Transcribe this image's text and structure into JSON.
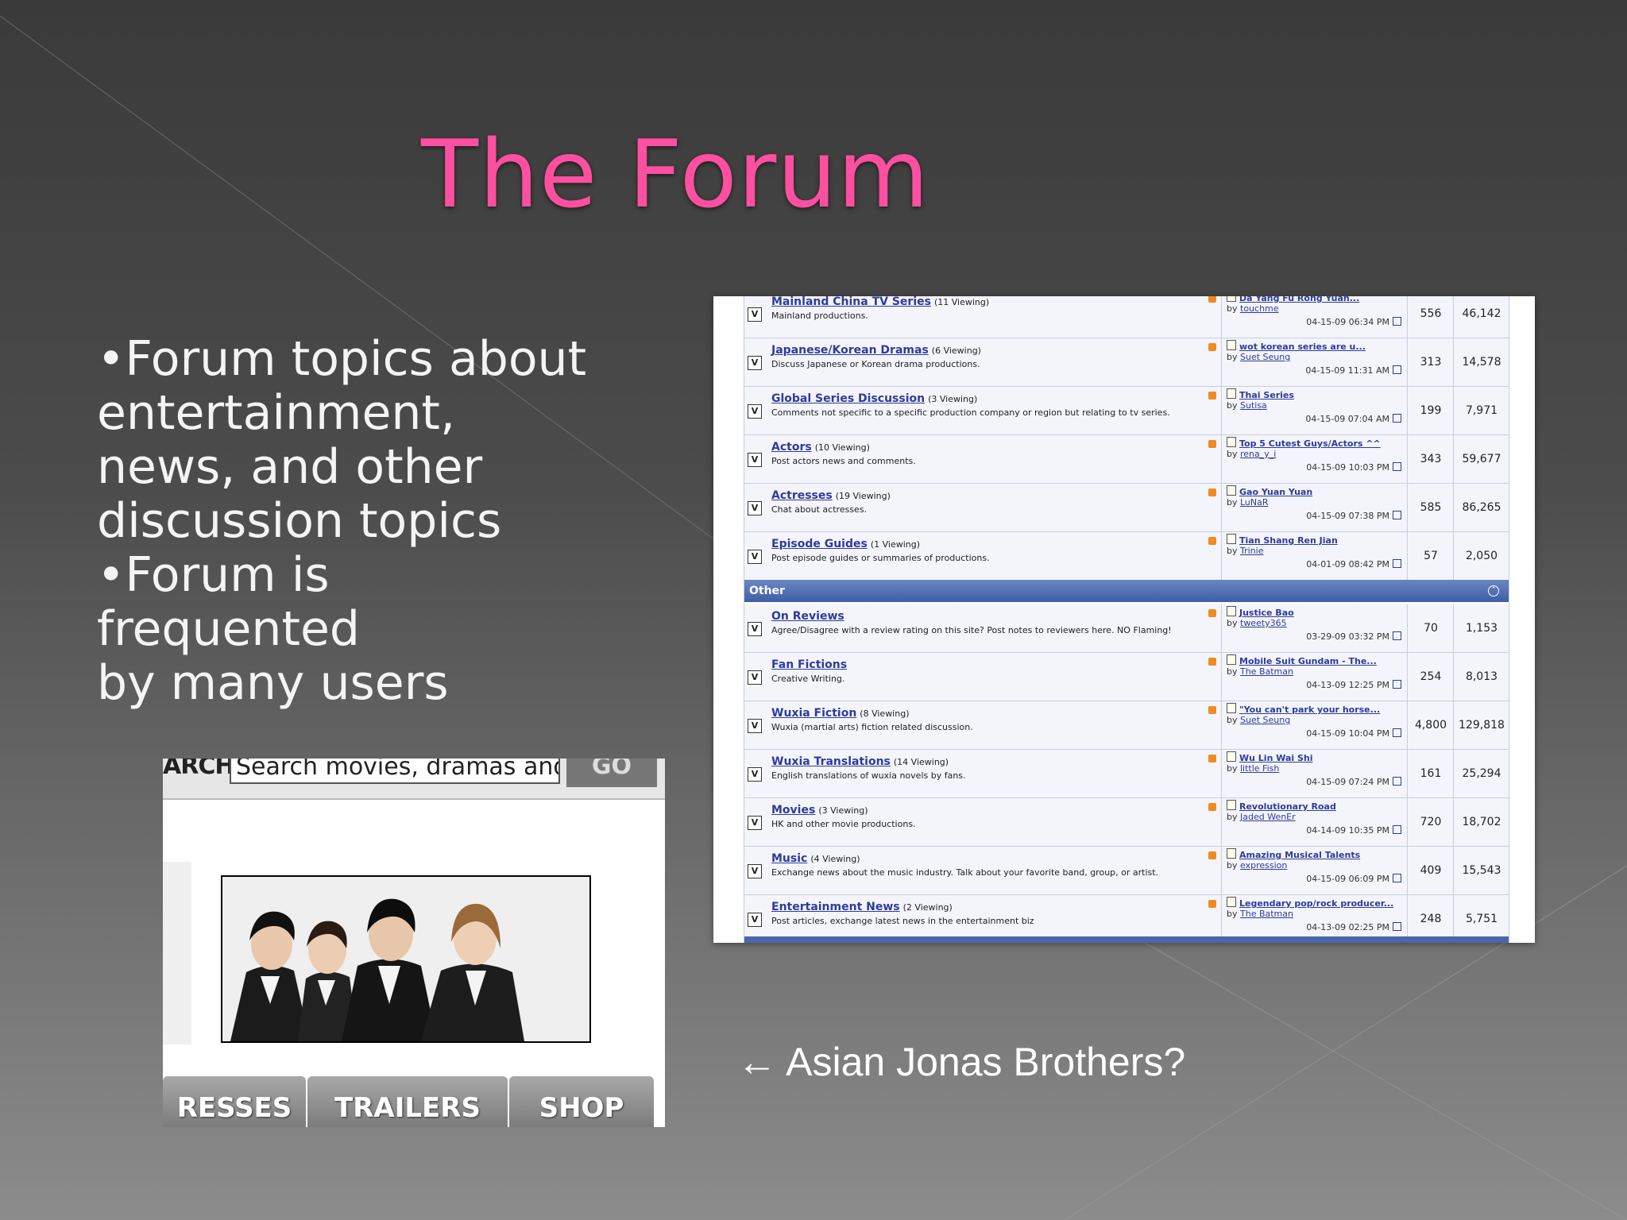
{
  "slide": {
    "title": "The Forum",
    "bullets": [
      "•Forum topics about",
      "entertainment,",
      "news, and other",
      "discussion topics",
      "•Forum is frequented",
      "by many users"
    ],
    "caption": "← Asian Jonas Brothers?",
    "title_color": "#ff4fa0"
  },
  "forum": {
    "rows_top": [
      {
        "name": "Mainland China TV Series",
        "viewing": "(11 Viewing)",
        "desc": "Mainland productions.",
        "last_title": "Da Yang Fu Rong Yuan...",
        "last_by": "touchme",
        "last_date": "04-15-09 06:34 PM",
        "threads": "556",
        "posts": "46,142"
      },
      {
        "name": "Japanese/Korean Dramas",
        "viewing": "(6 Viewing)",
        "desc": "Discuss Japanese or Korean drama productions.",
        "last_title": "wot korean series are u...",
        "last_by": "Suet Seung",
        "last_date": "04-15-09 11:31 AM",
        "threads": "313",
        "posts": "14,578"
      },
      {
        "name": "Global Series Discussion",
        "viewing": "(3 Viewing)",
        "desc": "Comments not specific to a specific production company or region but relating to tv series.",
        "last_title": "Thai Series",
        "last_by": "Sutisa",
        "last_date": "04-15-09 07:04 AM",
        "threads": "199",
        "posts": "7,971"
      },
      {
        "name": "Actors",
        "viewing": "(10 Viewing)",
        "desc": "Post actors news and comments.",
        "last_title": "Top 5 Cutest Guys/Actors ^^",
        "last_by": "rena_y_i",
        "last_date": "04-15-09 10:03 PM",
        "threads": "343",
        "posts": "59,677"
      },
      {
        "name": "Actresses",
        "viewing": "(19 Viewing)",
        "desc": "Chat about actresses.",
        "last_title": "Gao Yuan Yuan",
        "last_by": "LuNaR",
        "last_date": "04-15-09 07:38 PM",
        "threads": "585",
        "posts": "86,265"
      },
      {
        "name": "Episode Guides",
        "viewing": "(1 Viewing)",
        "desc": "Post episode guides or summaries of productions.",
        "last_title": "Tian Shang Ren Jian",
        "last_by": "Trinie",
        "last_date": "04-01-09 08:42 PM",
        "threads": "57",
        "posts": "2,050"
      }
    ],
    "section_header": "Other",
    "rows_other": [
      {
        "name": "On Reviews",
        "viewing": "",
        "desc": "Agree/Disagree with a review rating on this site? Post notes to reviewers here. NO Flaming!",
        "last_title": "Justice Bao",
        "last_by": "tweety365",
        "last_date": "03-29-09 03:32 PM",
        "threads": "70",
        "posts": "1,153"
      },
      {
        "name": "Fan Fictions",
        "viewing": "",
        "desc": "Creative Writing.",
        "last_title": "Mobile Suit Gundam - The...",
        "last_by": "The Batman",
        "last_date": "04-13-09 12:25 PM",
        "threads": "254",
        "posts": "8,013"
      },
      {
        "name": "Wuxia Fiction",
        "viewing": "(8 Viewing)",
        "desc": "Wuxia (martial arts) fiction related discussion.",
        "last_title": "\"You can't park your horse...",
        "last_by": "Suet Seung",
        "last_date": "04-15-09 10:04 PM",
        "threads": "4,800",
        "posts": "129,818"
      },
      {
        "name": "Wuxia Translations",
        "viewing": "(14 Viewing)",
        "desc": "English translations of wuxia novels by fans.",
        "last_title": "Wu Lin Wai Shi",
        "last_by": "little Fish",
        "last_date": "04-15-09 07:24 PM",
        "threads": "161",
        "posts": "25,294"
      },
      {
        "name": "Movies",
        "viewing": "(3 Viewing)",
        "desc": "HK and other movie productions.",
        "last_title": "Revolutionary Road",
        "last_by": "Jaded WenEr",
        "last_date": "04-14-09 10:35 PM",
        "threads": "720",
        "posts": "18,702"
      },
      {
        "name": "Music",
        "viewing": "(4 Viewing)",
        "desc": "Exchange news about the music industry. Talk about your favorite band, group, or artist.",
        "last_title": "Amazing Musical Talents",
        "last_by": "expression",
        "last_date": "04-15-09 06:09 PM",
        "threads": "409",
        "posts": "15,543"
      },
      {
        "name": "Entertainment News",
        "viewing": "(2 Viewing)",
        "desc": "Post articles, exchange latest news in the entertainment biz",
        "last_title": "Legendary pop/rock producer...",
        "last_by": "The Batman",
        "last_date": "04-13-09 02:25 PM",
        "threads": "248",
        "posts": "5,751"
      }
    ],
    "by_label": "by",
    "checkbox_glyph": "V"
  },
  "site": {
    "search_label": "ARCH",
    "search_value": "Search movies, dramas and m",
    "go_label": "GO",
    "tabs": [
      "RESSES",
      "TRAILERS",
      "SHOP"
    ]
  }
}
